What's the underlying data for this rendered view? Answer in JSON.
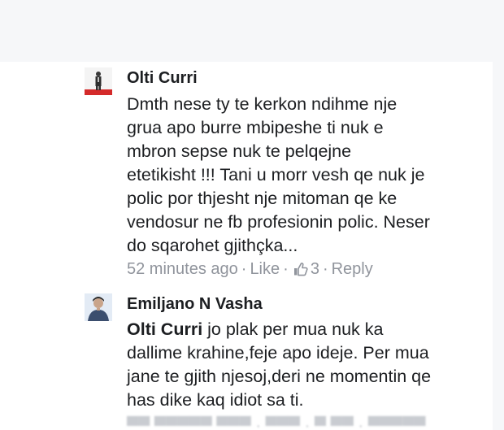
{
  "comments": [
    {
      "author": "Olti Curri",
      "lines": [
        "Dmth nese ty te kerkon ndihme nje",
        "grua apo burre mbipeshe ti nuk e",
        "mbron sepse nuk te pelqejne",
        "etetikisht !!! Tani u morr vesh qe nuk je",
        "polic por thjesht nje mitoman qe ke",
        "vendosur ne fb profesionin polic. Neser",
        "do sqarohet gjithçka..."
      ],
      "time": "52 minutes ago",
      "like_label": "Like",
      "reaction_icon": "thumbs-up-icon",
      "reaction_count": "3",
      "reply_label": "Reply"
    },
    {
      "author": "Emiljano N Vasha",
      "mention": "Olti Curri",
      "first_line_rest": " jo plak per mua nuk ka",
      "lines": [
        "dallime krahine,feje apo ideje. Per mua",
        "jane te gjith njesoj,deri ne momentin qe",
        "has dike kaq idiot sa ti."
      ]
    }
  ],
  "colors": {
    "page_background": "#f6f7f9",
    "text": "#1c1e21",
    "meta": "#90949c"
  }
}
